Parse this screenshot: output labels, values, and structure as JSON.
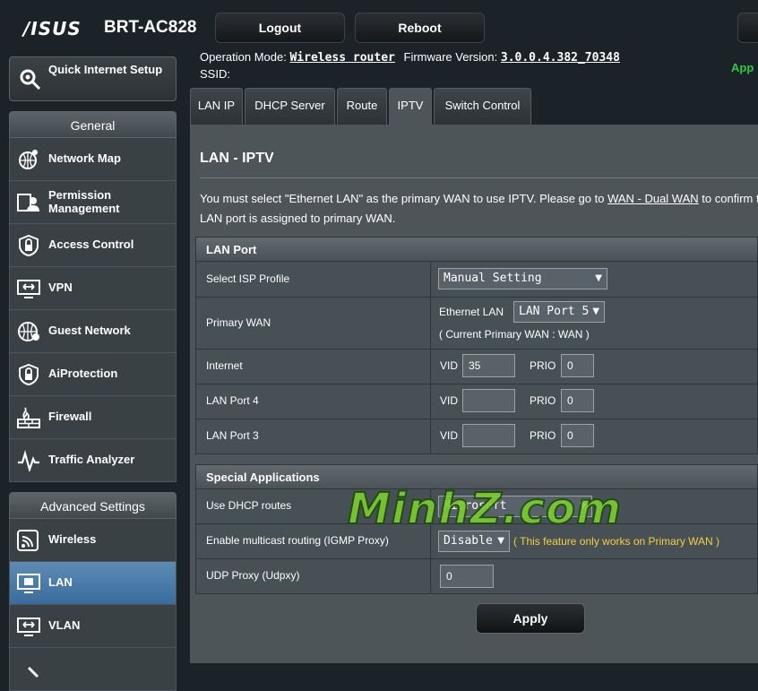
{
  "header": {
    "brand": "/ISUS",
    "model": "BRT-AC828",
    "logout_label": "Logout",
    "reboot_label": "Reboot",
    "op_mode_label": "Operation Mode:",
    "op_mode_value": "Wireless router",
    "fw_label": "Firmware Version:",
    "fw_value": "3.0.0.4.382_70348",
    "ssid_label": "SSID:",
    "app_label": "App"
  },
  "sidebar": {
    "qis_label": "Quick Internet Setup",
    "general_label": "General",
    "general_items": [
      {
        "label": "Network Map",
        "icon": "network-map-icon"
      },
      {
        "label": "Permission Management",
        "icon": "permission-icon"
      },
      {
        "label": "Access Control",
        "icon": "lock-icon"
      },
      {
        "label": "VPN",
        "icon": "vpn-icon"
      },
      {
        "label": "Guest Network",
        "icon": "globe-icon"
      },
      {
        "label": "AiProtection",
        "icon": "shield-lock-icon"
      },
      {
        "label": "Firewall",
        "icon": "firewall-icon"
      },
      {
        "label": "Traffic Analyzer",
        "icon": "traffic-icon"
      }
    ],
    "advanced_label": "Advanced Settings",
    "advanced_items": [
      {
        "label": "Wireless",
        "icon": "wifi-icon"
      },
      {
        "label": "LAN",
        "icon": "lan-icon",
        "active": true
      },
      {
        "label": "VLAN",
        "icon": "vlan-icon"
      }
    ]
  },
  "tabs": [
    "LAN IP",
    "DHCP Server",
    "Route",
    "IPTV",
    "Switch Control"
  ],
  "active_tab": "IPTV",
  "page": {
    "title": "LAN - IPTV",
    "desc_part1": "You must select \"Ethernet LAN\" as the primary WAN to use IPTV. Please go to ",
    "desc_link": "WAN - Dual WAN",
    "desc_part2": " to confirm t",
    "desc_line2": "LAN port is assigned to primary WAN."
  },
  "lan_port": {
    "section_label": "LAN Port",
    "isp_profile_label": "Select ISP Profile",
    "isp_profile_value": "Manual Setting",
    "primary_wan_label": "Primary WAN",
    "ethernet_lan_label": "Ethernet LAN",
    "ethernet_lan_value": "LAN Port 5",
    "current_primary": "( Current Primary WAN : WAN )",
    "vid_label": "VID",
    "prio_label": "PRIO",
    "rows": [
      {
        "label": "Internet",
        "vid": "35",
        "prio": "0"
      },
      {
        "label": "LAN Port 4",
        "vid": "",
        "prio": "0"
      },
      {
        "label": "LAN Port 3",
        "vid": "",
        "prio": "0"
      }
    ]
  },
  "special": {
    "section_label": "Special Applications",
    "dhcp_routes_label": "Use DHCP routes",
    "dhcp_routes_value": "Microsoft",
    "multicast_label": "Enable multicast routing (IGMP Proxy)",
    "multicast_value": "Disable",
    "multicast_note": "( This feature only works on Primary WAN )",
    "udp_label": "UDP Proxy (Udpxy)",
    "udp_value": "0"
  },
  "apply_label": "Apply",
  "watermark": "MinhZ.com"
}
